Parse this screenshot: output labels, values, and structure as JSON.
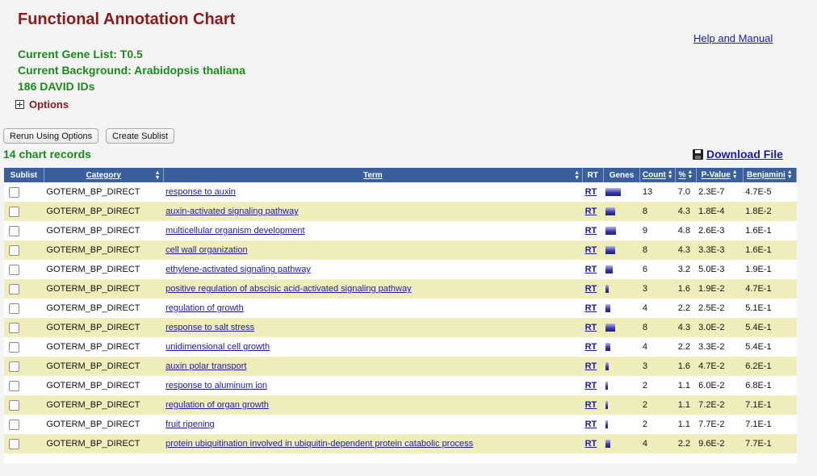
{
  "page": {
    "title": "Functional Annotation Chart",
    "help_link": "Help and Manual",
    "gene_list": "Current Gene List: T0.5",
    "background": "Current Background: Arabidopsis thaliana",
    "david_ids": "186 DAVID IDs",
    "options_label": "Options",
    "rerun_button": "Rerun Using Options",
    "create_sublist_button": "Create Sublist",
    "record_count": "14 chart records",
    "download_label": "Download File"
  },
  "colors": {
    "title": "#8b1a1a",
    "info_green": "#1a8a1a",
    "header_blue": "#3a5f9a",
    "row_alt": "#efeebb",
    "link": "#1a1aa6"
  },
  "table": {
    "headers": {
      "sublist": "Sublist",
      "category": "Category",
      "term": "Term",
      "rt": "RT",
      "genes": "Genes",
      "count": "Count",
      "percent": "%",
      "pvalue": "P-Value",
      "benjamini": "Benjamini"
    },
    "rows": [
      {
        "category": "GOTERM_BP_DIRECT",
        "term": "response to auxin",
        "rt": "RT",
        "count": "13",
        "percent": "7.0",
        "pvalue": "2.3E-7",
        "benjamini": "4.7E-5"
      },
      {
        "category": "GOTERM_BP_DIRECT",
        "term": "auxin-activated signaling pathway",
        "rt": "RT",
        "count": "8",
        "percent": "4.3",
        "pvalue": "1.8E-4",
        "benjamini": "1.8E-2"
      },
      {
        "category": "GOTERM_BP_DIRECT",
        "term": "multicellular organism development",
        "rt": "RT",
        "count": "9",
        "percent": "4.8",
        "pvalue": "2.6E-3",
        "benjamini": "1.6E-1"
      },
      {
        "category": "GOTERM_BP_DIRECT",
        "term": "cell wall organization",
        "rt": "RT",
        "count": "8",
        "percent": "4.3",
        "pvalue": "3.3E-3",
        "benjamini": "1.6E-1"
      },
      {
        "category": "GOTERM_BP_DIRECT",
        "term": "ethylene-activated signaling pathway",
        "rt": "RT",
        "count": "6",
        "percent": "3.2",
        "pvalue": "5.0E-3",
        "benjamini": "1.9E-1"
      },
      {
        "category": "GOTERM_BP_DIRECT",
        "term": "positive regulation of abscisic acid-activated signaling pathway",
        "rt": "RT",
        "count": "3",
        "percent": "1.6",
        "pvalue": "1.9E-2",
        "benjamini": "4.7E-1"
      },
      {
        "category": "GOTERM_BP_DIRECT",
        "term": "regulation of growth",
        "rt": "RT",
        "count": "4",
        "percent": "2.2",
        "pvalue": "2.5E-2",
        "benjamini": "5.1E-1"
      },
      {
        "category": "GOTERM_BP_DIRECT",
        "term": "response to salt stress",
        "rt": "RT",
        "count": "8",
        "percent": "4.3",
        "pvalue": "3.0E-2",
        "benjamini": "5.4E-1"
      },
      {
        "category": "GOTERM_BP_DIRECT",
        "term": "unidimensional cell growth",
        "rt": "RT",
        "count": "4",
        "percent": "2.2",
        "pvalue": "3.3E-2",
        "benjamini": "5.4E-1"
      },
      {
        "category": "GOTERM_BP_DIRECT",
        "term": "auxin polar transport",
        "rt": "RT",
        "count": "3",
        "percent": "1.6",
        "pvalue": "4.7E-2",
        "benjamini": "6.2E-1"
      },
      {
        "category": "GOTERM_BP_DIRECT",
        "term": "response to aluminum ion",
        "rt": "RT",
        "count": "2",
        "percent": "1.1",
        "pvalue": "6.0E-2",
        "benjamini": "6.8E-1"
      },
      {
        "category": "GOTERM_BP_DIRECT",
        "term": "regulation of organ growth",
        "rt": "RT",
        "count": "2",
        "percent": "1.1",
        "pvalue": "7.2E-2",
        "benjamini": "7.1E-1"
      },
      {
        "category": "GOTERM_BP_DIRECT",
        "term": "fruit ripening",
        "rt": "RT",
        "count": "2",
        "percent": "1.1",
        "pvalue": "7.7E-2",
        "benjamini": "7.1E-1"
      },
      {
        "category": "GOTERM_BP_DIRECT",
        "term": "protein ubiquitination involved in ubiquitin-dependent protein catabolic process",
        "rt": "RT",
        "count": "4",
        "percent": "2.2",
        "pvalue": "9.6E-2",
        "benjamini": "7.7E-1"
      }
    ]
  }
}
